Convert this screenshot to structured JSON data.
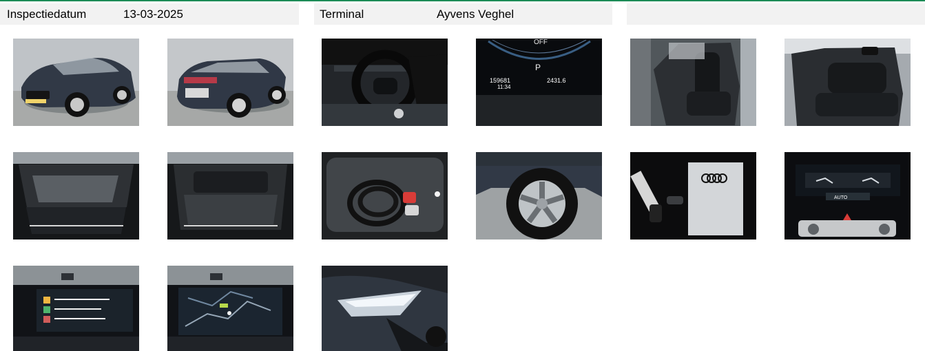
{
  "header": {
    "inspection_date_label": "Inspectiedatum",
    "inspection_date_value": "13-03-2025",
    "terminal_label": "Terminal",
    "terminal_value": "Ayvens Veghel"
  },
  "colors": {
    "top_rule": "#1c8c57",
    "strip_bg": "#f2f2f2"
  },
  "photos": [
    {
      "icon": "car-front-photo"
    },
    {
      "icon": "car-rear-photo"
    },
    {
      "icon": "steering-wheel-photo"
    },
    {
      "icon": "odometer-photo",
      "text_1": "OFF",
      "text_2": "P",
      "text_3": "159681",
      "text_4": "2431.6",
      "text_5": "11:34"
    },
    {
      "icon": "front-seats-photo"
    },
    {
      "icon": "rear-seats-photo"
    },
    {
      "icon": "trunk-cover-photo"
    },
    {
      "icon": "trunk-open-photo"
    },
    {
      "icon": "charging-cable-photo"
    },
    {
      "icon": "wheel-photo"
    },
    {
      "icon": "keys-manual-photo"
    },
    {
      "icon": "climate-panel-photo",
      "text_1": "AUTO"
    },
    {
      "icon": "infotainment-menu-photo"
    },
    {
      "icon": "navigation-screen-photo"
    },
    {
      "icon": "headlight-photo"
    }
  ]
}
